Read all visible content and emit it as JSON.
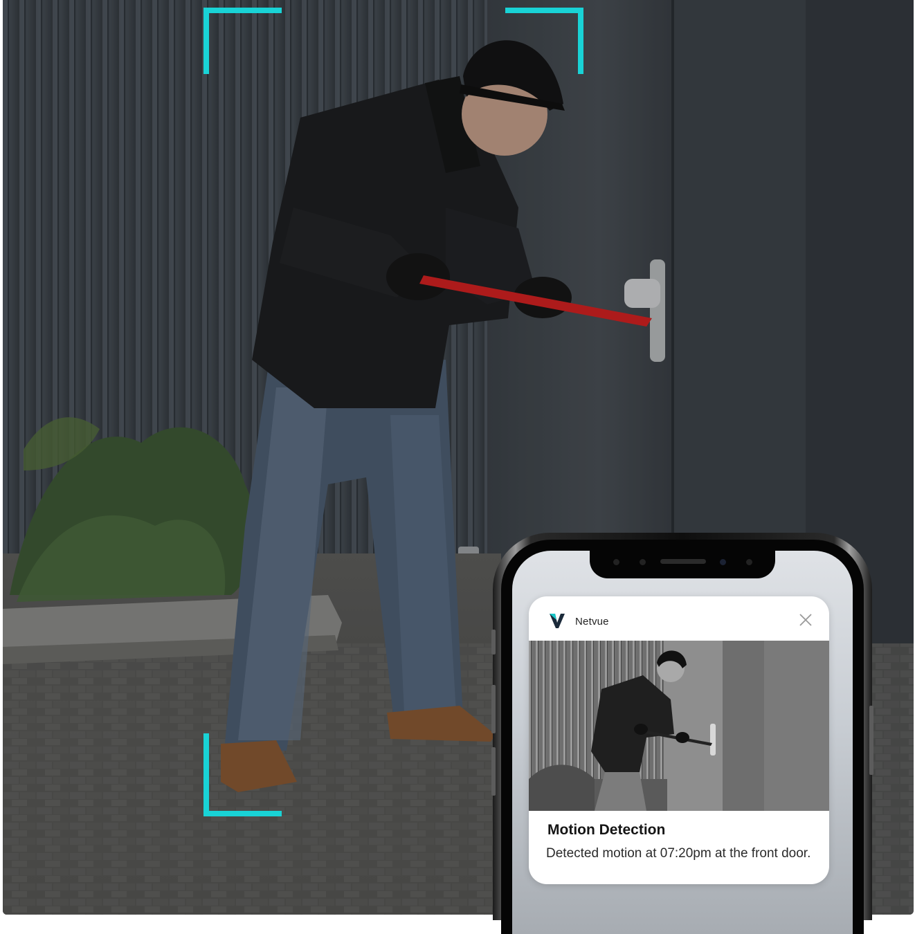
{
  "photo": {
    "description_icon": "security-camera-scene"
  },
  "brackets": {
    "color": "#19d3d6"
  },
  "notification": {
    "app_name": "Netvue",
    "app_icon": "netvue-v-logo-icon",
    "close_icon": "close-icon",
    "title": "Motion Detection",
    "body": "Detected motion at 07:20pm at the front door."
  }
}
